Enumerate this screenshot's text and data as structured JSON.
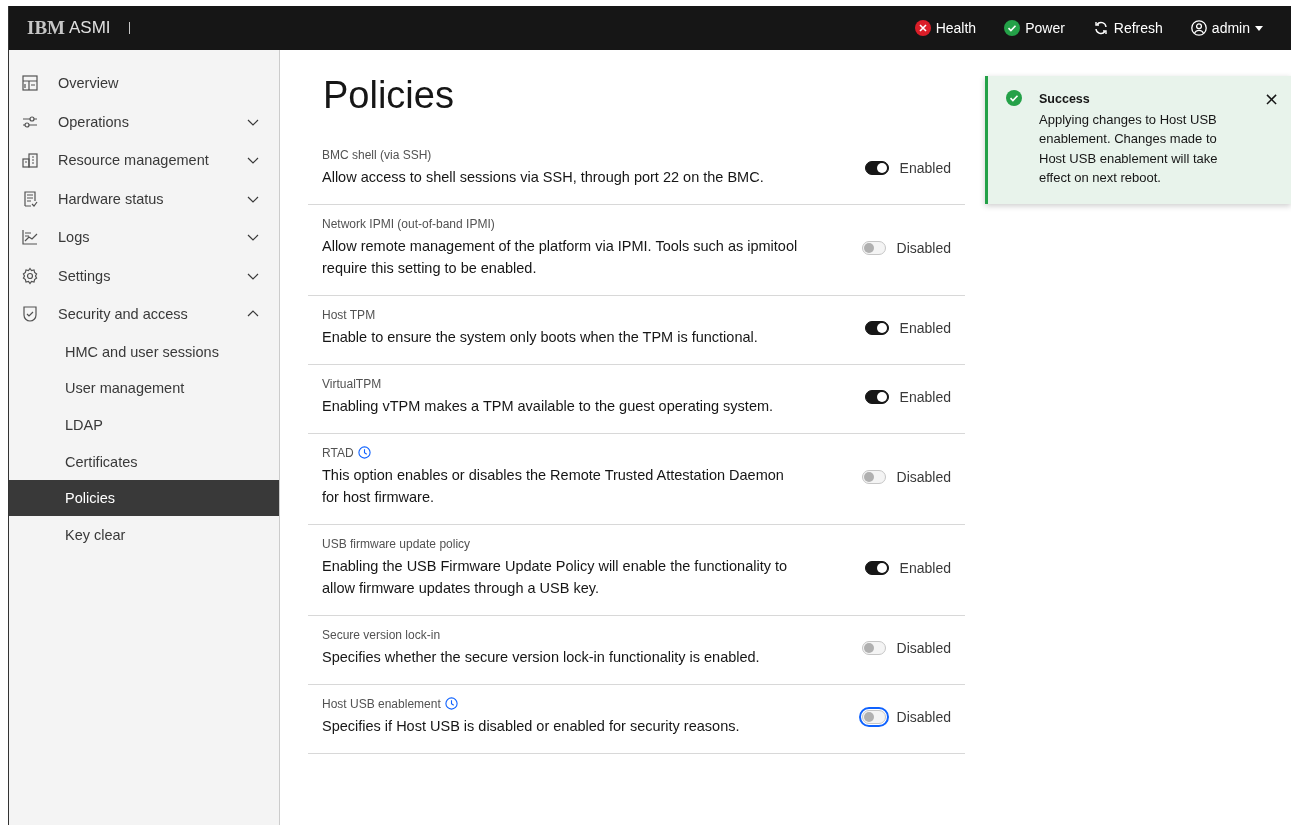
{
  "header": {
    "logo": "IBM",
    "product": "ASMI",
    "actions": [
      {
        "kind": "status",
        "label": "Health",
        "color": "#da1e28"
      },
      {
        "kind": "status",
        "label": "Power",
        "color": "#24a148"
      },
      {
        "kind": "refresh",
        "label": "Refresh"
      },
      {
        "kind": "user",
        "label": "admin"
      }
    ]
  },
  "sidebar": {
    "items": [
      {
        "kind": "link",
        "label": "Overview"
      },
      {
        "kind": "group",
        "label": "Operations",
        "expanded": false
      },
      {
        "kind": "group",
        "label": "Resource management",
        "expanded": false
      },
      {
        "kind": "group",
        "label": "Hardware status",
        "expanded": false
      },
      {
        "kind": "group",
        "label": "Logs",
        "expanded": false
      },
      {
        "kind": "group",
        "label": "Settings",
        "expanded": false
      },
      {
        "kind": "group",
        "label": "Security and access",
        "expanded": true,
        "children": [
          {
            "label": "HMC and user sessions",
            "selected": false
          },
          {
            "label": "User management",
            "selected": false
          },
          {
            "label": "LDAP",
            "selected": false
          },
          {
            "label": "Certificates",
            "selected": false
          },
          {
            "label": "Policies",
            "selected": true
          },
          {
            "label": "Key clear",
            "selected": false
          }
        ]
      }
    ]
  },
  "page": {
    "title": "Policies",
    "policies": [
      {
        "name": "BMC shell (via SSH)",
        "clock_icon": false,
        "description": "Allow access to shell sessions via SSH, through port 22 on the BMC.",
        "on": true,
        "focused": false,
        "state_label": "Enabled"
      },
      {
        "name": "Network IPMI (out-of-band IPMI)",
        "clock_icon": false,
        "description": "Allow remote management of the platform via IPMI. Tools such as ipmitool require this setting to be enabled.",
        "on": false,
        "focused": false,
        "state_label": "Disabled"
      },
      {
        "name": "Host TPM",
        "clock_icon": false,
        "description": "Enable to ensure the system only boots when the TPM is functional.",
        "on": true,
        "focused": false,
        "state_label": "Enabled"
      },
      {
        "name": "VirtualTPM",
        "clock_icon": false,
        "description": "Enabling vTPM makes a TPM available to the guest operating system.",
        "on": true,
        "focused": false,
        "state_label": "Enabled"
      },
      {
        "name": "RTAD",
        "clock_icon": true,
        "description": "This option enables or disables the Remote Trusted Attestation Daemon for host firmware.",
        "on": false,
        "focused": false,
        "state_label": "Disabled"
      },
      {
        "name": "USB firmware update policy",
        "clock_icon": false,
        "description": "Enabling the USB Firmware Update Policy will enable the functionality to allow firmware updates through a USB key.",
        "on": true,
        "focused": false,
        "state_label": "Enabled"
      },
      {
        "name": "Secure version lock-in",
        "clock_icon": false,
        "description": "Specifies whether the secure version lock-in functionality is enabled.",
        "on": false,
        "focused": false,
        "state_label": "Disabled"
      },
      {
        "name": "Host USB enablement",
        "clock_icon": true,
        "description": "Specifies if Host USB is disabled or enabled for security reasons.",
        "on": false,
        "focused": true,
        "state_label": "Disabled"
      }
    ]
  },
  "toast": {
    "kind": "success",
    "title": "Success",
    "message": "Applying changes to Host USB enablement. Changes made to Host USB enablement will take effect on next reboot.",
    "close": "×"
  }
}
